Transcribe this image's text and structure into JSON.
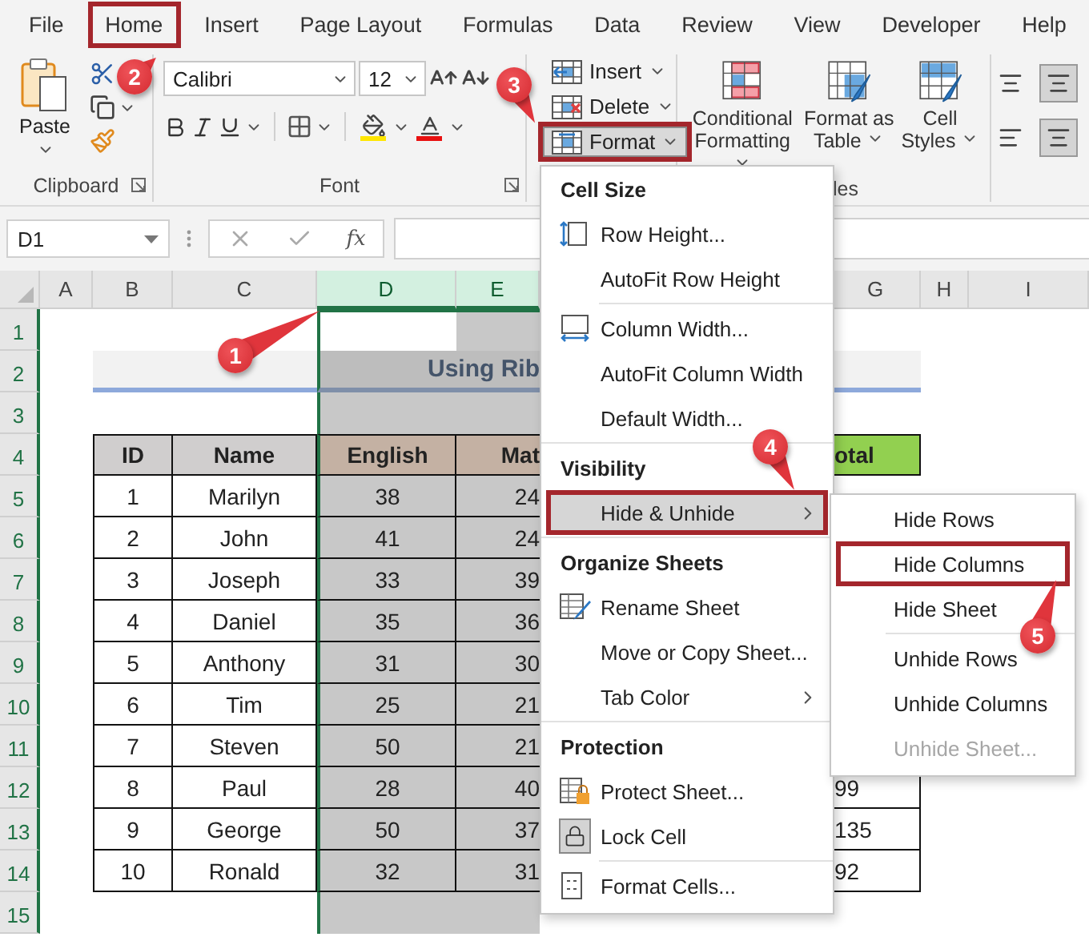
{
  "tabs": [
    {
      "label": "File",
      "outlined": false
    },
    {
      "label": "Home",
      "outlined": true
    },
    {
      "label": "Insert",
      "outlined": false
    },
    {
      "label": "Page Layout",
      "outlined": false
    },
    {
      "label": "Formulas",
      "outlined": false
    },
    {
      "label": "Data",
      "outlined": false
    },
    {
      "label": "Review",
      "outlined": false
    },
    {
      "label": "View",
      "outlined": false
    },
    {
      "label": "Developer",
      "outlined": false
    },
    {
      "label": "Help",
      "outlined": false
    }
  ],
  "ribbon": {
    "clipboard": {
      "paste_label": "Paste",
      "group_label": "Clipboard"
    },
    "font": {
      "font_name": "Calibri",
      "font_size": "12",
      "group_label": "Font"
    },
    "cells": {
      "buttons": [
        {
          "label": "Insert",
          "outlined": false
        },
        {
          "label": "Delete",
          "outlined": false
        },
        {
          "label": "Format",
          "outlined": true
        }
      ]
    },
    "styles": {
      "buttons": [
        {
          "label": "Conditional Formatting"
        },
        {
          "label": "Format as Table"
        },
        {
          "label": "Cell Styles"
        }
      ],
      "group_label": "les"
    }
  },
  "formula_bar": {
    "name_box": "D1",
    "function_label": "fx"
  },
  "sheet": {
    "column_headers": [
      {
        "label": "A",
        "selected": false
      },
      {
        "label": "B",
        "selected": false
      },
      {
        "label": "C",
        "selected": false
      },
      {
        "label": "D",
        "selected": true
      },
      {
        "label": "E",
        "selected": true
      },
      {
        "label": "G",
        "selected": false
      },
      {
        "label": "H",
        "selected": false
      },
      {
        "label": "I",
        "selected": false
      }
    ],
    "row_headers": [
      "1",
      "2",
      "3",
      "4",
      "5",
      "6",
      "7",
      "8",
      "9",
      "10",
      "11",
      "12",
      "13",
      "14",
      "15"
    ],
    "title": "Using Rib",
    "table": {
      "columns": [
        "ID",
        "Name",
        "English",
        "Mat",
        "otal"
      ],
      "rows": [
        {
          "id": "1",
          "name": "Marilyn",
          "english": "38",
          "math": "24"
        },
        {
          "id": "2",
          "name": "John",
          "english": "41",
          "math": "24"
        },
        {
          "id": "3",
          "name": "Joseph",
          "english": "33",
          "math": "39"
        },
        {
          "id": "4",
          "name": "Daniel",
          "english": "35",
          "math": "36"
        },
        {
          "id": "5",
          "name": "Anthony",
          "english": "31",
          "math": "30"
        },
        {
          "id": "6",
          "name": "Tim",
          "english": "25",
          "math": "21"
        },
        {
          "id": "7",
          "name": "Steven",
          "english": "50",
          "math": "21"
        },
        {
          "id": "8",
          "name": "Paul",
          "english": "28",
          "math": "40",
          "total": "99"
        },
        {
          "id": "9",
          "name": "George",
          "english": "50",
          "math": "37",
          "total": "135"
        },
        {
          "id": "10",
          "name": "Ronald",
          "english": "32",
          "math": "31",
          "total": "92"
        }
      ]
    }
  },
  "format_menu": {
    "sections": [
      {
        "heading": "Cell Size",
        "groups": [
          [
            {
              "label": "Row Height...",
              "highlighted": false,
              "outlined": false,
              "has_submenu": false
            },
            {
              "label": "AutoFit Row Height",
              "highlighted": false,
              "outlined": false,
              "has_submenu": false
            }
          ],
          [
            {
              "label": "Column Width...",
              "highlighted": false,
              "outlined": false,
              "has_submenu": false
            },
            {
              "label": "AutoFit Column Width",
              "highlighted": false,
              "outlined": false,
              "has_submenu": false
            },
            {
              "label": "Default Width...",
              "highlighted": false,
              "outlined": false,
              "has_submenu": false
            }
          ]
        ]
      },
      {
        "heading": "Visibility",
        "groups": [
          [
            {
              "label": "Hide & Unhide",
              "highlighted": true,
              "outlined": true,
              "has_submenu": true
            }
          ]
        ]
      },
      {
        "heading": "Organize Sheets",
        "groups": [
          [
            {
              "label": "Rename Sheet",
              "highlighted": false,
              "outlined": false,
              "has_submenu": false
            },
            {
              "label": "Move or Copy Sheet...",
              "highlighted": false,
              "outlined": false,
              "has_submenu": false
            },
            {
              "label": "Tab Color",
              "highlighted": false,
              "outlined": false,
              "has_submenu": true
            }
          ]
        ]
      },
      {
        "heading": "Protection",
        "groups": [
          [
            {
              "label": "Protect Sheet...",
              "highlighted": false,
              "outlined": false,
              "has_submenu": false
            },
            {
              "label": "Lock Cell",
              "highlighted": false,
              "outlined": false,
              "has_submenu": false,
              "checked": true
            }
          ],
          [
            {
              "label": "Format Cells...",
              "highlighted": false,
              "outlined": false,
              "has_submenu": false
            }
          ]
        ]
      }
    ]
  },
  "submenu": {
    "groups": [
      [
        {
          "label": "Hide Rows",
          "outlined": false,
          "disabled": false
        },
        {
          "label": "Hide Columns",
          "outlined": true,
          "disabled": false
        },
        {
          "label": "Hide Sheet",
          "outlined": false,
          "disabled": false
        }
      ],
      [
        {
          "label": "Unhide Rows",
          "outlined": false,
          "disabled": false
        },
        {
          "label": "Unhide Columns",
          "outlined": false,
          "disabled": false
        },
        {
          "label": "Unhide Sheet...",
          "outlined": false,
          "disabled": true
        }
      ]
    ]
  },
  "callouts": [
    {
      "label": "1"
    },
    {
      "label": "2"
    },
    {
      "label": "3"
    },
    {
      "label": "4"
    },
    {
      "label": "5"
    }
  ]
}
